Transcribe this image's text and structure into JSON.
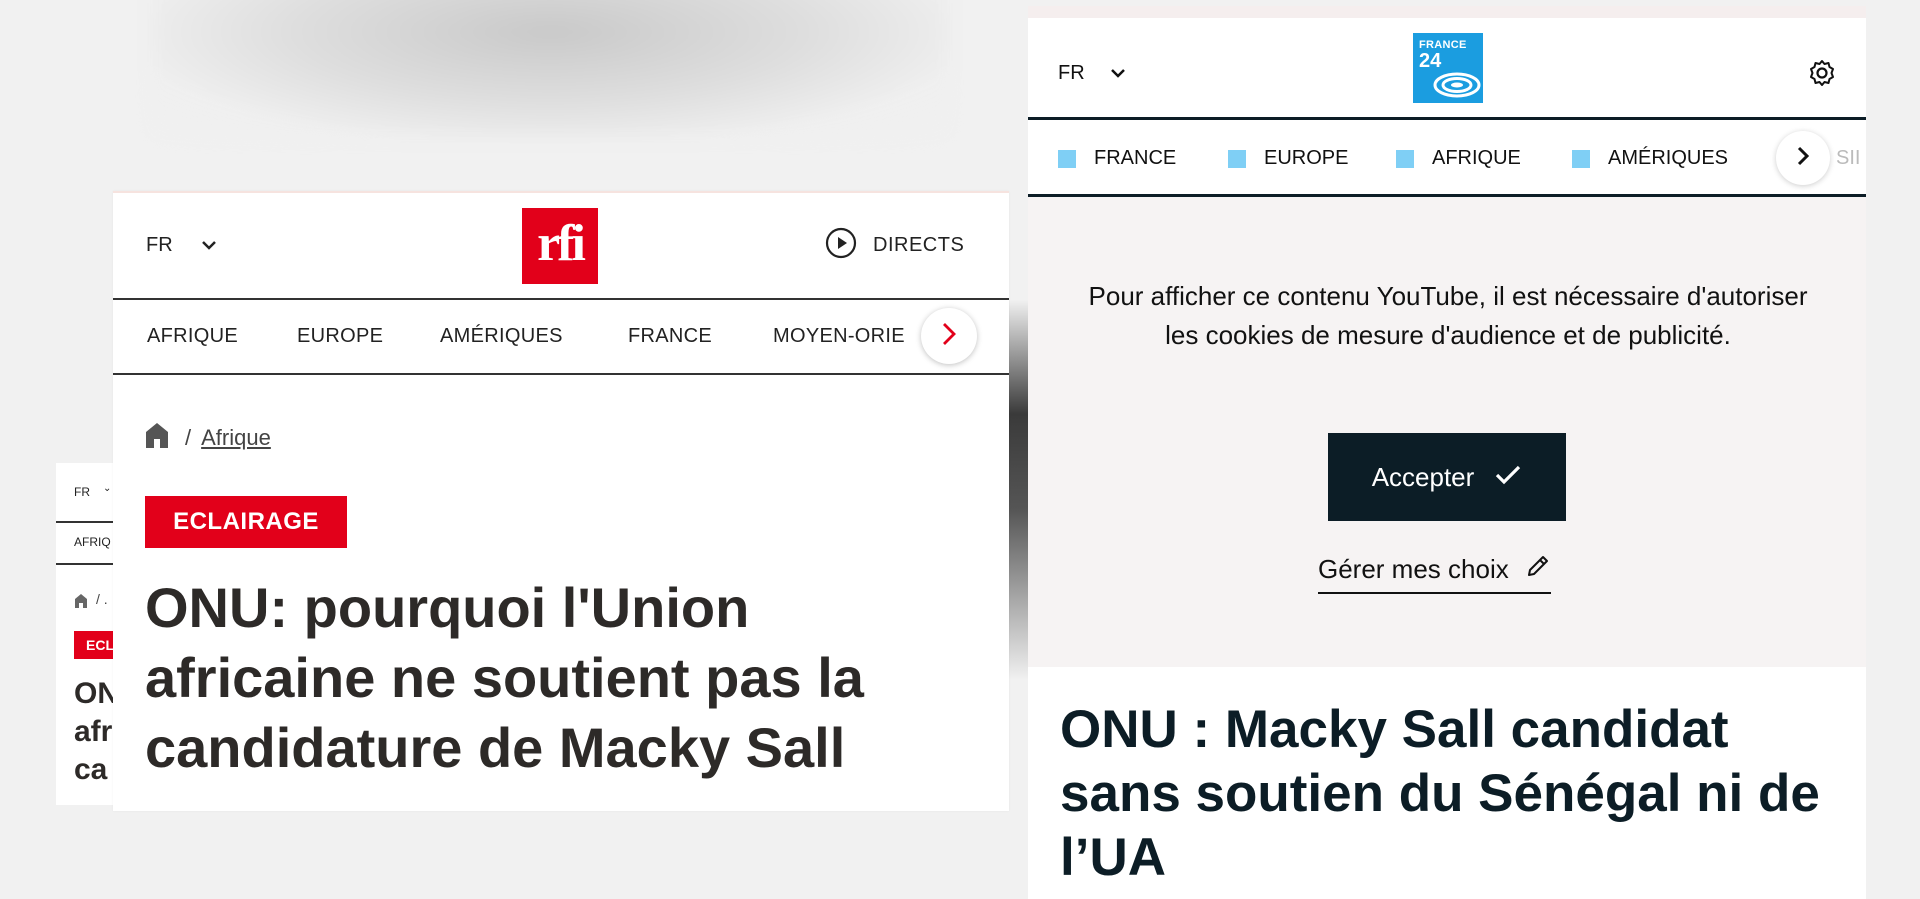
{
  "small_card": {
    "lang": "FR",
    "nav_item": "AFRIQ",
    "badge": "ECL",
    "title_lines": [
      "ON",
      "afr",
      "ca"
    ]
  },
  "rfi": {
    "lang": "FR",
    "logo_text": "rfi",
    "directs_label": "DIRECTS",
    "nav": [
      "AFRIQUE",
      "EUROPE",
      "AMÉRIQUES",
      "FRANCE",
      "MOYEN-ORIE"
    ],
    "breadcrumb": {
      "separator": "/",
      "link": "Afrique"
    },
    "badge": "ECLAIRAGE",
    "title": "ONU: pourquoi l'Union africaine ne soutient pas la candidature de Macky Sall",
    "colors": {
      "brand": "#e2001a",
      "text": "#2d2a28"
    }
  },
  "france24": {
    "lang": "FR",
    "logo_line1": "FRANCE",
    "logo_line2": "24",
    "nav": [
      "FRANCE",
      "EUROPE",
      "AFRIQUE",
      "AMÉRIQUES"
    ],
    "nav_faded": "SII",
    "consent_message": "Pour afficher ce contenu YouTube, il est nécessaire d'autoriser les cookies de mesure d'audience et de publicité.",
    "accept_label": "Accepter",
    "manage_label": "Gérer mes choix",
    "title": "ONU : Macky Sall candidat sans soutien du Sénégal ni de l’UA",
    "colors": {
      "brand": "#1b9de0",
      "accent_square": "#7fcff5",
      "dark": "#0c1d26"
    }
  }
}
